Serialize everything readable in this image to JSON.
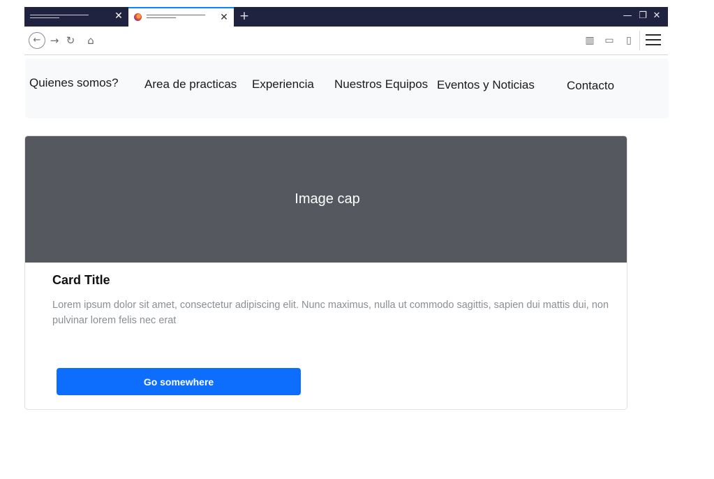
{
  "browser": {
    "tabs": [
      {
        "title": "",
        "active": false
      },
      {
        "title": "",
        "active": true
      }
    ],
    "icons": {
      "close": "close-icon",
      "new_tab": "plus-icon",
      "minimize": "minimize-icon",
      "restore": "restore-icon",
      "window_close": "close-icon",
      "back": "back-icon",
      "forward": "forward-icon",
      "reload": "reload-icon",
      "home": "home-icon",
      "library": "library-icon",
      "reader": "reader-icon",
      "sidebar": "sidebar-icon",
      "menu": "hamburger-menu-icon"
    },
    "glyphs": {
      "tab_close": "✕",
      "new_tab": "+",
      "minimize": "—",
      "restore": "❐",
      "window_close": "✕",
      "back": "←",
      "forward": "→",
      "reload": "↻",
      "home": "⌂",
      "library": "▥",
      "reader": "▭",
      "sidebar": "▯"
    },
    "colors": {
      "titlebar": "#202340",
      "active_tab_accent": "#0a84ff"
    }
  },
  "site_nav": {
    "links": [
      "Quienes somos?",
      "Area de practicas",
      "Experiencia",
      "Nuestros Equipos",
      "Eventos y Noticias",
      "Contacto"
    ]
  },
  "card": {
    "image_cap": "Image cap",
    "title": "Card Title",
    "text": "Lorem ipsum dolor sit amet, consectetur adipiscing elit. Nunc maximus, nulla ut commodo sagittis, sapien dui mattis dui, non pulvinar lorem felis nec erat",
    "button_label": "Go somewhere",
    "colors": {
      "image_bg": "#55595f",
      "button_bg": "#0d6efd"
    }
  }
}
